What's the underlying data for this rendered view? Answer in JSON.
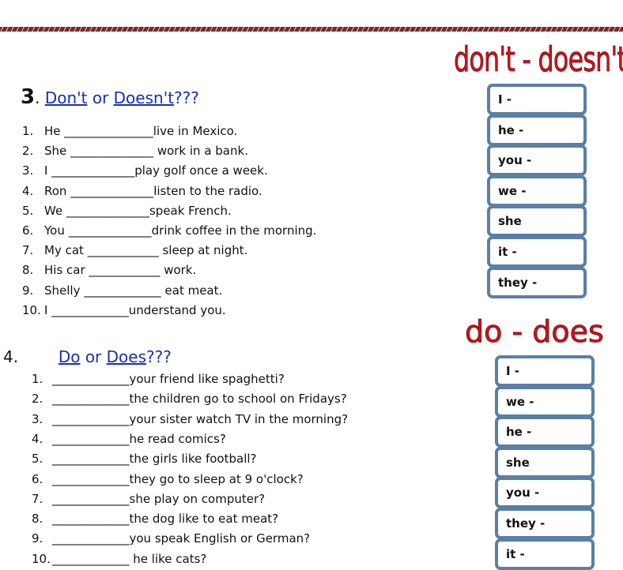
{
  "header": {
    "title_dont": "don't - doesn't",
    "title_do": "do - does"
  },
  "section3": {
    "number": "3",
    "dot": ".",
    "link1": "Don't",
    "or": "or",
    "link2": "Doesn't",
    "suffix": "???",
    "items": [
      {
        "num": "1.",
        "subject": "He",
        "blank": "_______________",
        "rest": "live in Mexico."
      },
      {
        "num": "2.",
        "subject": "She",
        "blank": "______________",
        "rest": " work in a bank."
      },
      {
        "num": "3.",
        "subject": "I",
        "blank": "______________",
        "rest": "play golf once a week."
      },
      {
        "num": "4.",
        "subject": "Ron",
        "blank": "______________",
        "rest": "listen to the radio."
      },
      {
        "num": "5.",
        "subject": "We",
        "blank": "______________",
        "rest": "speak French."
      },
      {
        "num": "6.",
        "subject": "You",
        "blank": "______________",
        "rest": "drink coffee in the morning."
      },
      {
        "num": "7.",
        "subject": "My cat",
        "blank": "____________",
        "rest": " sleep at night."
      },
      {
        "num": "8.",
        "subject": "His car",
        "blank": "____________",
        "rest": " work."
      },
      {
        "num": "9.",
        "subject": "Shelly",
        "blank": "_____________",
        "rest": " eat meat."
      },
      {
        "num": "10.",
        "subject": "I",
        "blank": "_____________",
        "rest": "understand you."
      }
    ],
    "pronouns": [
      "I -",
      "he -",
      "you -",
      "we -",
      "she",
      "it -",
      "they -"
    ]
  },
  "section4": {
    "number": "4.",
    "link1": "Do",
    "or": "or",
    "link2": "Does",
    "suffix": "???",
    "items": [
      {
        "num": "1.",
        "blank": "_____________",
        "rest": "your friend like spaghetti?"
      },
      {
        "num": "2.",
        "blank": "_____________",
        "rest": "the children go to school on Fridays?"
      },
      {
        "num": "3.",
        "blank": "_____________",
        "rest": "your sister watch TV in the morning?"
      },
      {
        "num": "4.",
        "blank": "_____________",
        "rest": "he read comics?"
      },
      {
        "num": "5.",
        "blank": "_____________",
        "rest": "the girls like football?"
      },
      {
        "num": "6.",
        "blank": "_____________",
        "rest": "they go to sleep at 9 o'clock?"
      },
      {
        "num": "7.",
        "blank": "_____________",
        "rest": "she play on computer?"
      },
      {
        "num": "8.",
        "blank": "_____________",
        "rest": "the dog like to eat meat?"
      },
      {
        "num": "9.",
        "blank": "_____________",
        "rest": "you speak English or German?"
      },
      {
        "num": "10.",
        "blank": "_____________",
        "rest": " he like cats?"
      }
    ],
    "pronouns": [
      "I -",
      "we -",
      "he -",
      "she",
      "you -",
      "they -",
      "it -"
    ]
  },
  "colors": {
    "title_red": "#c8141c",
    "link_blue": "#1a2fb0",
    "box_border": "#5a7fa6",
    "rope": "#7a2a2e"
  }
}
